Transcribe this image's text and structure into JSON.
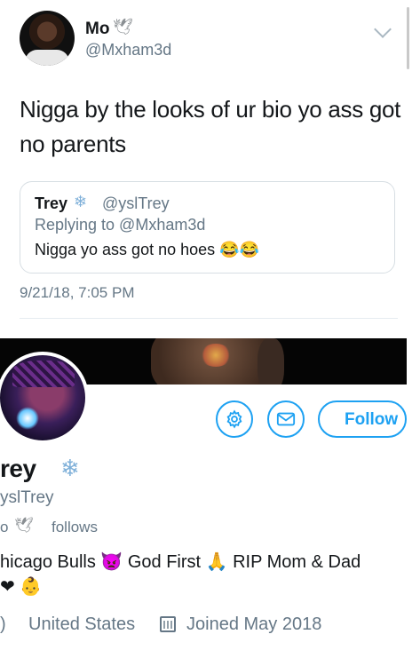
{
  "tweet": {
    "author_name": "Mo",
    "author_badge": "🕊",
    "author_handle": "@Mxham3d",
    "text": "Nigga by the looks of ur bio yo ass got no parents",
    "timestamp": "9/21/18, 7:05 PM"
  },
  "quoted": {
    "author_name": "Trey",
    "author_badge": "❄",
    "author_handle": "@yslTrey",
    "replying_to": "Replying to @Mxham3d",
    "text": "Nigga yo ass got no hoes 😂😂"
  },
  "profile": {
    "name": "rey",
    "badge": "❄",
    "handle": "yslTrey",
    "follows_prefix": "o",
    "follows_badge": "🕊",
    "follows_label": "follows",
    "bio_line1": "hicago Bulls 👿 God First 🙏 RIP Mom & Dad",
    "bio_line2": "❤ 👶",
    "location_icon": ")",
    "location": "United States",
    "joined": "Joined May 2018",
    "follow_label": "Follow"
  },
  "icons": {
    "caret": "chevron-down-icon",
    "settings": "gear-icon",
    "message": "envelope-icon",
    "calendar": "calendar-icon"
  },
  "colors": {
    "accent": "#1da1f2",
    "muted": "#657786"
  }
}
